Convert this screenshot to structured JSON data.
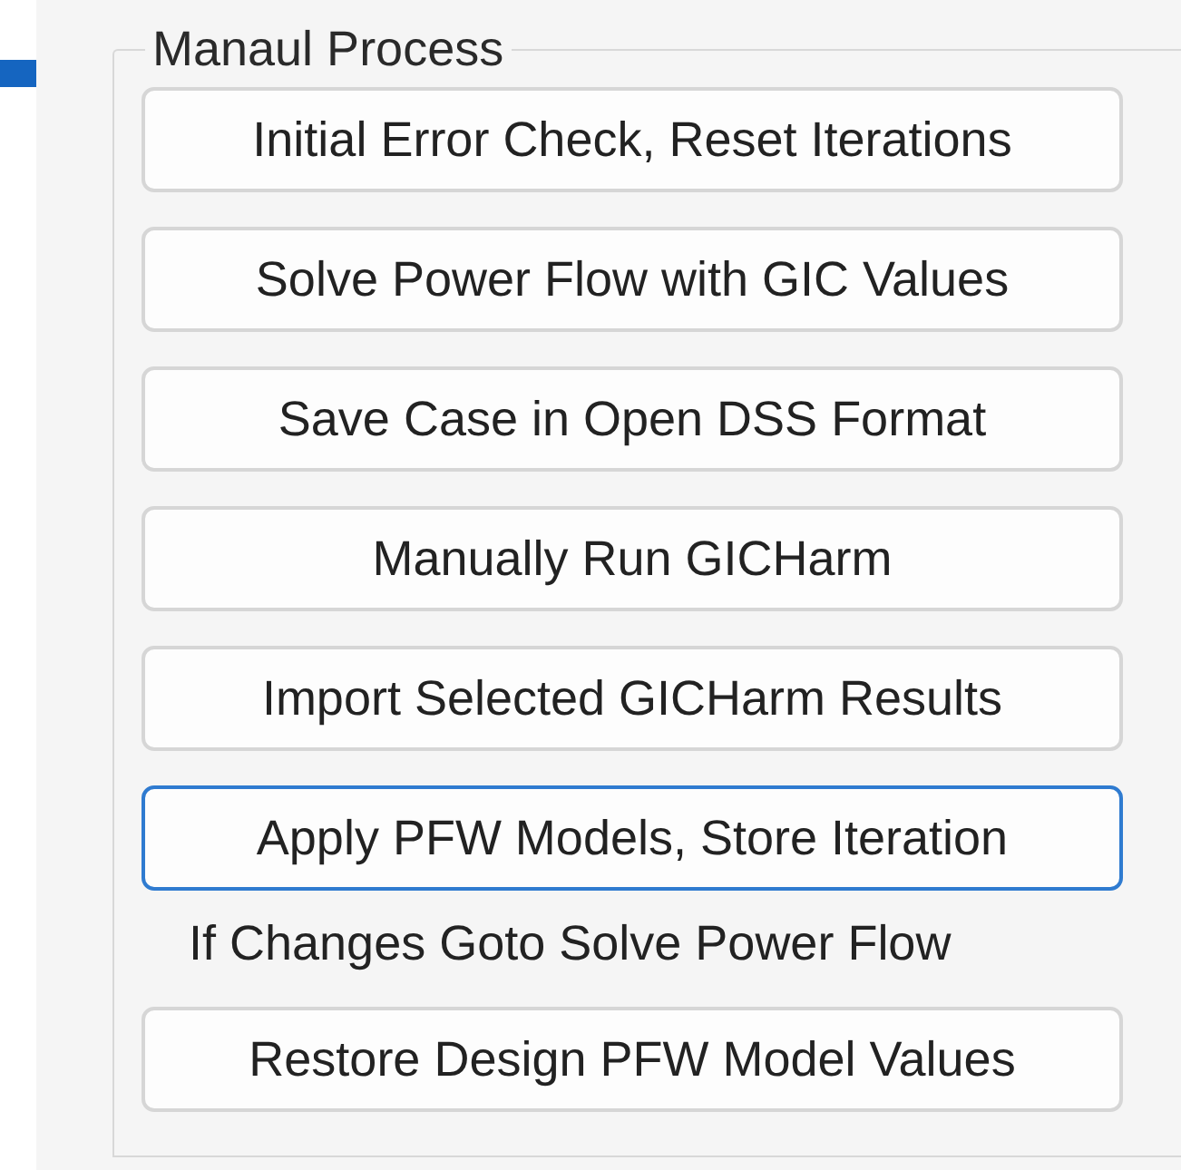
{
  "group": {
    "title": "Manaul Process",
    "items": [
      {
        "kind": "button",
        "label": "Initial Error Check, Reset Iterations",
        "focused": false
      },
      {
        "kind": "button",
        "label": "Solve Power Flow with GIC Values",
        "focused": false
      },
      {
        "kind": "button",
        "label": "Save Case in Open DSS Format",
        "focused": false
      },
      {
        "kind": "button",
        "label": "Manually Run GICHarm",
        "focused": false
      },
      {
        "kind": "button",
        "label": "Import Selected GICHarm Results",
        "focused": false
      },
      {
        "kind": "button",
        "label": "Apply PFW Models, Store Iteration",
        "focused": true
      },
      {
        "kind": "label",
        "label": "If Changes Goto Solve Power Flow"
      },
      {
        "kind": "button",
        "label": "Restore Design PFW Model Values",
        "focused": false
      }
    ]
  }
}
